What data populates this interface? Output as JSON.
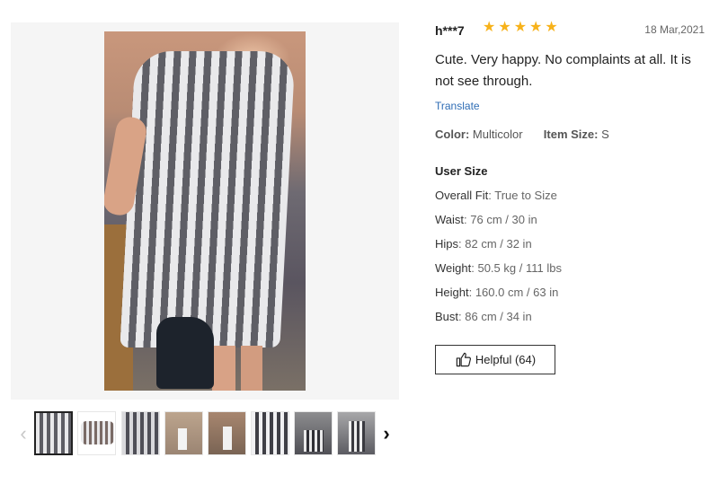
{
  "review": {
    "username": "h***7",
    "rating": 5,
    "date": "18 Mar,2021",
    "text": "Cute. Very happy. No complaints at all. It is not see through.",
    "translate_label": "Translate",
    "color_label": "Color",
    "color_value": "Multicolor",
    "item_size_label": "Item Size",
    "item_size_value": "S",
    "user_size_title": "User Size",
    "user_size": [
      {
        "label": "Overall Fit",
        "value": "True to Size"
      },
      {
        "label": "Waist",
        "value": "76 cm / 30 in"
      },
      {
        "label": "Hips",
        "value": "82 cm / 32 in"
      },
      {
        "label": "Weight",
        "value": "50.5 kg / 111 lbs"
      },
      {
        "label": "Height",
        "value": "160.0 cm / 63 in"
      },
      {
        "label": "Bust",
        "value": "86 cm / 34 in"
      }
    ],
    "helpful_label": "Helpful (64)"
  },
  "gallery": {
    "thumbnail_count": 8,
    "active_index": 0,
    "prev_icon": "chevron-left-icon",
    "next_icon": "chevron-right-icon"
  },
  "colors": {
    "star": "#f7b21a",
    "link": "#2f6db5",
    "photo_bg": "#f5f5f5"
  }
}
